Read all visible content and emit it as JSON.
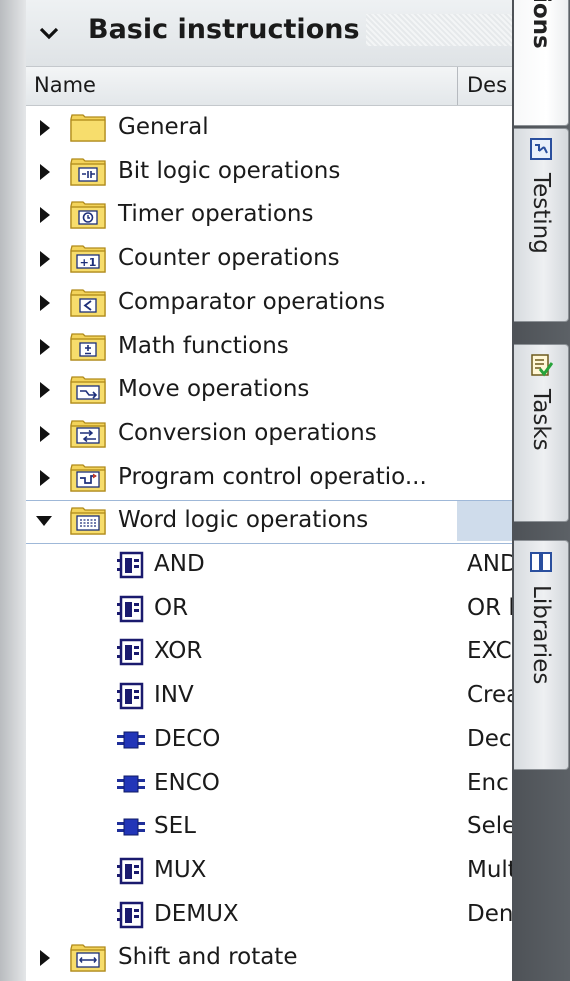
{
  "section": {
    "title": "Basic instructions"
  },
  "columns": {
    "name": "Name",
    "description": "Des"
  },
  "categories_top": [
    {
      "label": "General",
      "icon": "folder-icon"
    },
    {
      "label": "Bit logic operations",
      "icon": "bit-logic-folder-icon"
    },
    {
      "label": "Timer operations",
      "icon": "timer-folder-icon"
    },
    {
      "label": "Counter operations",
      "icon": "counter-folder-icon"
    },
    {
      "label": "Comparator operations",
      "icon": "comparator-folder-icon"
    },
    {
      "label": "Math functions",
      "icon": "math-folder-icon"
    },
    {
      "label": "Move operations",
      "icon": "move-folder-icon"
    },
    {
      "label": "Conversion operations",
      "icon": "conversion-folder-icon"
    },
    {
      "label": "Program control operatio...",
      "icon": "program-control-folder-icon"
    }
  ],
  "expanded_category": {
    "label": "Word logic operations",
    "icon": "word-logic-folder-icon",
    "expanded": true,
    "selected": true
  },
  "word_logic_items": [
    {
      "label": "AND",
      "desc": "AND",
      "icon": "box-instruction-icon"
    },
    {
      "label": "OR",
      "desc": "OR l",
      "icon": "box-instruction-icon"
    },
    {
      "label": "XOR",
      "desc": "EXC",
      "icon": "box-instruction-icon"
    },
    {
      "label": "INV",
      "desc": "Crea",
      "icon": "box-instruction-icon"
    },
    {
      "label": "DECO",
      "desc": "Dec",
      "icon": "blue-block-icon"
    },
    {
      "label": "ENCO",
      "desc": "Enc",
      "icon": "blue-block-icon"
    },
    {
      "label": "SEL",
      "desc": "Sele",
      "icon": "blue-block-icon"
    },
    {
      "label": "MUX",
      "desc": "Mult",
      "icon": "box-instruction-icon"
    },
    {
      "label": "DEMUX",
      "desc": "Den",
      "icon": "box-instruction-icon"
    }
  ],
  "categories_bottom": [
    {
      "label": "Shift and rotate",
      "icon": "shift-rotate-folder-icon"
    }
  ],
  "side_tabs": [
    {
      "label": "ions",
      "icon": "",
      "active": true
    },
    {
      "label": "Testing",
      "icon": "testing-icon",
      "active": false
    },
    {
      "label": "Tasks",
      "icon": "tasks-icon",
      "active": false
    },
    {
      "label": "Libraries",
      "icon": "libraries-icon",
      "active": false
    }
  ],
  "colors": {
    "folder_yellow": "#f3d35a",
    "selection_blue": "#cfdceb",
    "instruction_blue": "#1f2f9a",
    "tab_strip": "#54585d"
  }
}
